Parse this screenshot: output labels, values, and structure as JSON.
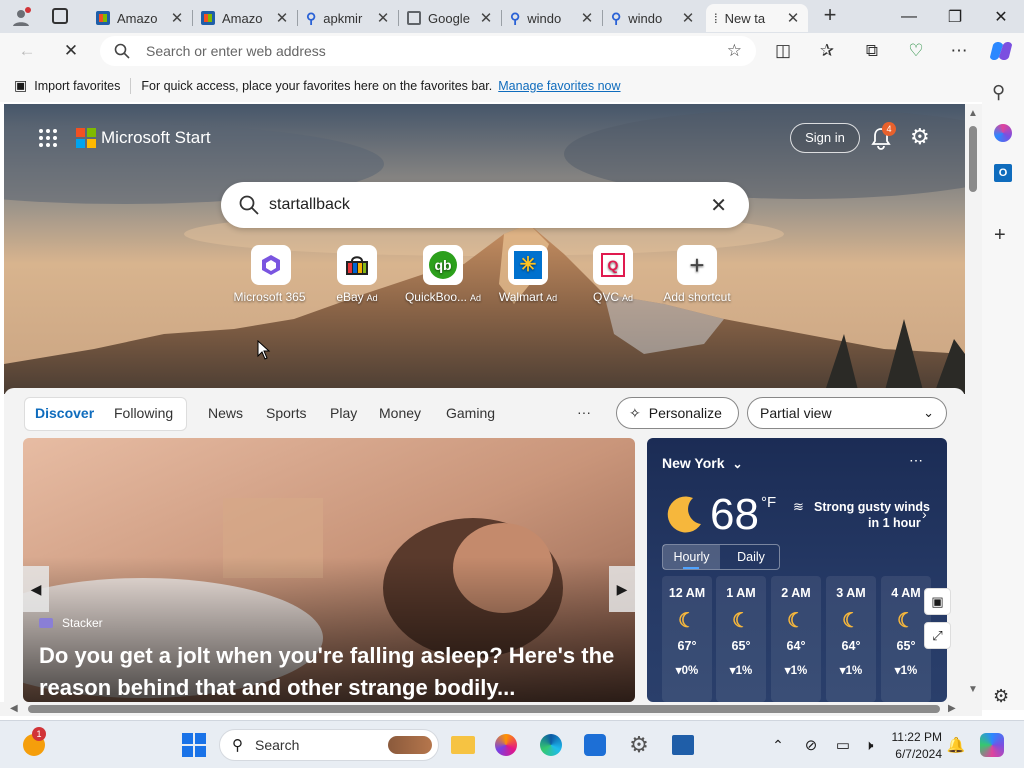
{
  "tabs": [
    {
      "title": "Amazo",
      "favicon": "ms-store-icon"
    },
    {
      "title": "Amazo",
      "favicon": "ms-store-icon"
    },
    {
      "title": "apkmir",
      "favicon": "search-icon"
    },
    {
      "title": "Google",
      "favicon": "page-icon"
    },
    {
      "title": "windo",
      "favicon": "search-icon"
    },
    {
      "title": "windo",
      "favicon": "search-icon"
    },
    {
      "title": "New ta",
      "favicon": "loading-icon"
    }
  ],
  "address": {
    "placeholder": "Search or enter web address"
  },
  "favbar": {
    "import": "Import favorites",
    "message": "For quick access, place your favorites here on the favorites bar.",
    "manage": "Manage favorites now"
  },
  "start": {
    "brand": "Microsoft Start",
    "signin": "Sign in",
    "notif_count": "4",
    "search_query": "startallback",
    "shortcuts": [
      {
        "label": "Microsoft 365",
        "ad": ""
      },
      {
        "label": "eBay",
        "ad": "Ad"
      },
      {
        "label": "QuickBoo...",
        "ad": "Ad"
      },
      {
        "label": "Walmart",
        "ad": "Ad"
      },
      {
        "label": "QVC",
        "ad": "Ad"
      },
      {
        "label": "Add shortcut",
        "ad": ""
      }
    ],
    "nav": {
      "discover": "Discover",
      "following": "Following",
      "items": [
        "News",
        "Sports",
        "Play",
        "Money",
        "Gaming"
      ],
      "more": "···",
      "personalize": "Personalize",
      "view": "Partial view"
    },
    "article": {
      "source": "Stacker",
      "headline": "Do you get a jolt when you're falling asleep? Here's the reason behind that and other strange bodily..."
    },
    "weather": {
      "location": "New York",
      "temp": "68",
      "unit": "°F",
      "alert_line1": "Strong gusty winds",
      "alert_line2": "in 1 hour",
      "tabs": [
        "Hourly",
        "Daily"
      ],
      "hours": [
        {
          "time": "12 AM",
          "temp": "67°",
          "precip": "0%"
        },
        {
          "time": "1 AM",
          "temp": "65°",
          "precip": "1%"
        },
        {
          "time": "2 AM",
          "temp": "64°",
          "precip": "1%"
        },
        {
          "time": "3 AM",
          "temp": "64°",
          "precip": "1%"
        },
        {
          "time": "4 AM",
          "temp": "65°",
          "precip": "1%"
        }
      ]
    }
  },
  "taskbar": {
    "search": "Search",
    "time": "11:22 PM",
    "date": "6/7/2024",
    "badge": "1"
  },
  "colors": {
    "accent": "#0f6cbd",
    "link": "#0f6cbd",
    "notif": "#e8612c"
  }
}
